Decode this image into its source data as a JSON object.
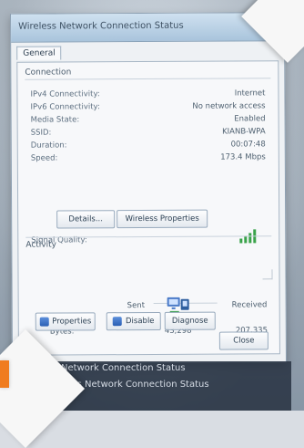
{
  "window": {
    "title": "Wireless Network Connection Status",
    "close_glyph": "✕"
  },
  "tabs": [
    {
      "label": "General"
    }
  ],
  "sections": {
    "connection": "Connection",
    "activity": "Activity"
  },
  "connection": {
    "rows": [
      {
        "key": "IPv4 Connectivity:",
        "value": "Internet"
      },
      {
        "key": "IPv6 Connectivity:",
        "value": "No network access"
      },
      {
        "key": "Media State:",
        "value": "Enabled"
      },
      {
        "key": "SSID:",
        "value": "KIANB-WPA"
      },
      {
        "key": "Duration:",
        "value": "00:07:48"
      },
      {
        "key": "Speed:",
        "value": "173.4 Mbps"
      }
    ],
    "signal_quality_label": "Signal Quality:"
  },
  "buttons": {
    "details": "Details...",
    "wireless_properties": "Wireless Properties",
    "properties": "Properties",
    "disable": "Disable",
    "diagnose": "Diagnose",
    "close": "Close"
  },
  "activity": {
    "sent_label": "Sent",
    "received_label": "Received",
    "bytes_label": "Bytes:",
    "bytes_sent": "43,298",
    "bytes_received": "207,335"
  },
  "bottom_caption": {
    "line1": "Wireless Network Connection Status",
    "line2": "Wireless Network Connection Status"
  },
  "icons": {
    "signal": "signal-bars-icon",
    "network": "network-adapter-icon",
    "shield": "shield-icon",
    "resize": "resize-grip-icon"
  },
  "colors": {
    "orange_tab": "#f07c1f",
    "signal_green": "#3aa34a",
    "title_bar": "#a9c4dc"
  }
}
